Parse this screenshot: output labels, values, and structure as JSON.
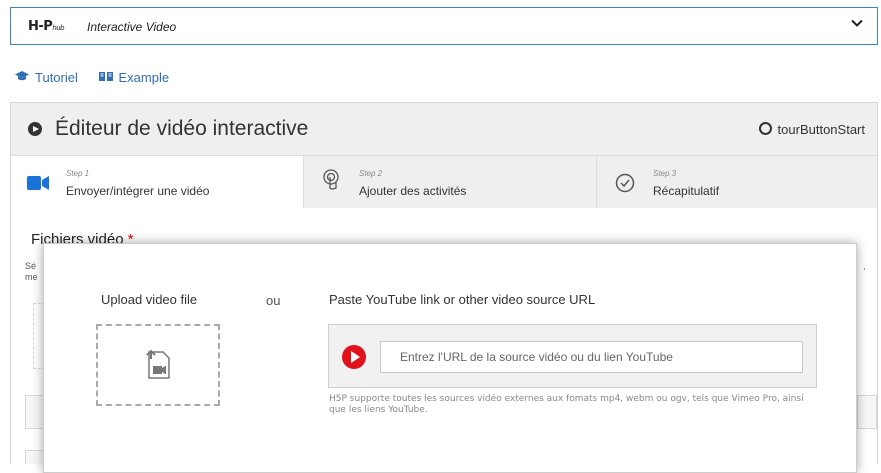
{
  "hub": {
    "logo_main": "H-P",
    "logo_sub": "hub",
    "content_type": "Interactive Video",
    "toggle_icon": "chevron-down-icon"
  },
  "links": [
    {
      "label": "Tutoriel",
      "icon": "graduation-cap-icon"
    },
    {
      "label": "Example",
      "icon": "book-icon"
    }
  ],
  "editor": {
    "title": "Éditeur de vidéo interactive",
    "tour_button": "tourButtonStart"
  },
  "steps": [
    {
      "number": "Step 1",
      "label": "Envoyer/intégrer une vidéo",
      "icon": "video-camera-icon",
      "active": true
    },
    {
      "number": "Step 2",
      "label": "Ajouter des activités",
      "icon": "touch-icon",
      "active": false
    },
    {
      "number": "Step 3",
      "label": "Récapitulatif",
      "icon": "check-circle-icon",
      "active": false
    }
  ],
  "section": {
    "label": "Fichiers vidéo",
    "required_mark": "*",
    "desc_fragment_1": "Sé",
    "desc_fragment_2": "me",
    "right_fragment": ","
  },
  "dialog": {
    "upload_title": "Upload video file",
    "separator": "ou",
    "paste_title": "Paste YouTube link or other video source URL",
    "url_placeholder": "Entrez l'URL de la source vidéo ou du lien YouTube",
    "help_text": "H5P supporte toutes les sources vidéo externes aux fomats mp4, webm ou ogv, tels que Vimeo Pro, ainsi que les liens YouTube."
  },
  "colors": {
    "accent": "#2f6fb5",
    "hub_border": "#3a82c4",
    "active_step_icon": "#1a73d9",
    "youtube_red": "#e1121a",
    "required": "#cc0000"
  }
}
